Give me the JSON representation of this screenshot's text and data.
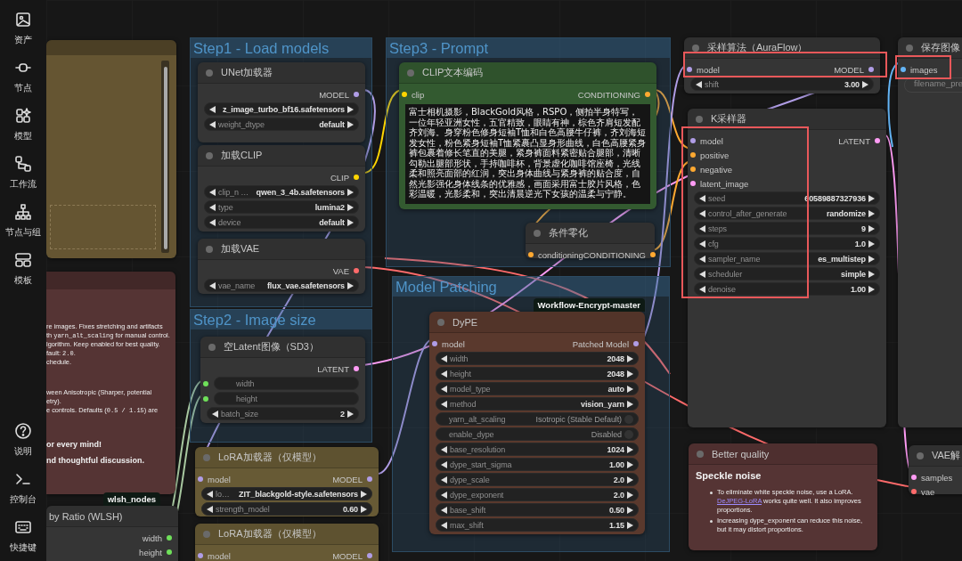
{
  "sidebar": {
    "items": [
      {
        "label": "资产"
      },
      {
        "label": "节点"
      },
      {
        "label": "模型"
      },
      {
        "label": "工作流"
      },
      {
        "label": "节点与组"
      },
      {
        "label": "模板"
      }
    ],
    "bottom_items": [
      {
        "label": "说明"
      },
      {
        "label": "控制台"
      },
      {
        "label": "快捷键"
      }
    ]
  },
  "groups": [
    {
      "title": "Step1 - Load models"
    },
    {
      "title": "Step2 - Image size"
    },
    {
      "title": "Step3 - Prompt"
    },
    {
      "title": "Model Patching"
    }
  ],
  "nodes": [
    {
      "kind": "note",
      "color": "#655532"
    },
    {
      "kind": "markdown",
      "color": "#553434",
      "blocks": [
        [
          [
            {
              "text": "re images. Fixes stretching and artifacts"
            }
          ],
          [
            {
              "text": "th "
            },
            {
              "text": "yarn_alt_scaling",
              "kind": "code"
            },
            {
              "text": " for manual control."
            }
          ],
          [
            {
              "text": "lgorithm. Keep enabled for best quality."
            }
          ],
          [
            {
              "text": "fault: "
            },
            {
              "text": "2.0",
              "kind": "code"
            },
            {
              "text": "."
            }
          ],
          [
            {
              "text": "chedule."
            }
          ]
        ],
        [
          [
            {
              "text": "ween Anisotropic (Sharper, potential"
            }
          ],
          [
            {
              "text": "etry)."
            }
          ],
          [
            {
              "text": "e controls. Defaults ("
            },
            {
              "text": "0.5 / 1.15",
              "kind": "code"
            },
            {
              "text": ") are"
            }
          ]
        ],
        [
          [
            {
              "text": "or every mind!",
              "kind": "bold"
            }
          ],
          [
            {
              "text": "nd thoughtful discussion.",
              "kind": "bold"
            }
          ]
        ]
      ]
    },
    {
      "kind": "node",
      "title": "by Ratio (WLSH)",
      "badge": "wlsh_nodes",
      "outputs": [
        {
          "name": "width",
          "color": "#6fe05a"
        },
        {
          "name": "height",
          "color": "#6fe05a"
        }
      ]
    },
    {
      "kind": "node",
      "title": "UNet加载器",
      "outputs": [
        {
          "name": "MODEL",
          "color": "#b09de6"
        }
      ],
      "widgets": [
        {
          "kind": "value",
          "value": "z_image_turbo_bf16.safetensors"
        },
        {
          "kind": "value",
          "label": "weight_dtype",
          "value": "default"
        }
      ]
    },
    {
      "kind": "node",
      "title": "加载CLIP",
      "outputs": [
        {
          "name": "CLIP",
          "color": "#ffd500"
        }
      ],
      "widgets": [
        {
          "kind": "value",
          "label": "clip_n …",
          "value": "qwen_3_4b.safetensors"
        },
        {
          "kind": "value",
          "label": "type",
          "value": "lumina2"
        },
        {
          "kind": "value",
          "label": "device",
          "value": "default"
        }
      ]
    },
    {
      "kind": "node",
      "title": "加载VAE",
      "outputs": [
        {
          "name": "VAE",
          "color": "#ff6b6b"
        }
      ],
      "widgets": [
        {
          "kind": "value",
          "label": "vae_name",
          "value": "flux_vae.safetensors"
        }
      ]
    },
    {
      "kind": "node",
      "title": "空Latent图像（SD3）",
      "outputs": [
        {
          "name": "LATENT",
          "color": "#ff9cf5"
        }
      ],
      "widgets": [
        {
          "kind": "socket",
          "label": "width",
          "color": "#6fe05a"
        },
        {
          "kind": "socket",
          "label": "height",
          "color": "#6fe05a"
        },
        {
          "kind": "value",
          "label": "batch_size",
          "value": "2"
        }
      ]
    },
    {
      "kind": "node",
      "title": "LoRA加载器（仅模型）",
      "color": "#675a35",
      "inputs": [
        {
          "name": "model",
          "color": "#b09de6"
        }
      ],
      "outputs": [
        {
          "name": "MODEL",
          "color": "#b09de6"
        }
      ],
      "widgets": [
        {
          "kind": "value",
          "label": "lo…",
          "value": "ZIT_blackgold-style.safetensors"
        },
        {
          "kind": "value",
          "label": "strength_model",
          "value": "0.60"
        }
      ]
    },
    {
      "kind": "node",
      "title": "LoRA加载器（仅模型）",
      "color": "#675a35",
      "inputs": [
        {
          "name": "model",
          "color": "#b09de6"
        }
      ],
      "outputs": [
        {
          "name": "MODEL",
          "color": "#b09de6"
        }
      ]
    },
    {
      "kind": "node",
      "title": "CLIP文本编码",
      "color": "#335a30",
      "inputs": [
        {
          "name": "clip",
          "color": "#ffd500"
        }
      ],
      "outputs": [
        {
          "name": "CONDITIONING",
          "color": "#ffa931"
        }
      ],
      "widgets": [
        {
          "kind": "textarea",
          "value": "富士相机摄影，BlackGold风格，RSPO，侧拍半身特写，一位年轻亚洲女性，五官精致，眼睛有神，棕色齐肩短发配齐刘海。身穿粉色修身短袖T恤和白色高腰牛仔裤，齐刘海短发女性，粉色紧身短袖T恤紧裹凸显身形曲线，白色高腰紧身裤包裹着修长笔直的美腿，紧身裤面料紧密贴合腿部，清晰勾勒出腿部形状，手持咖啡杯，背景虚化咖啡馆座椅，光线柔和照亮面部的红润，突出身体曲线与紧身裤的贴合度，自然光影强化身体线条的优雅感，画面采用富士胶片风格，色彩温暖，光影柔和，突出清晨逆光下女孩的温柔与宁静。"
        }
      ]
    },
    {
      "kind": "node",
      "title": "条件零化",
      "inputs": [
        {
          "name": "conditioning",
          "color": "#ffa931"
        }
      ],
      "outputs": [
        {
          "name": "CONDITIONING",
          "color": "#ffa931"
        }
      ]
    },
    {
      "kind": "node",
      "title": "DyPE",
      "color": "#5a392d",
      "badge": "Workflow-Encrypt-master",
      "inputs": [
        {
          "name": "model",
          "color": "#b09de6"
        }
      ],
      "outputs": [
        {
          "name": "Patched Model",
          "color": "#b09de6"
        }
      ],
      "widgets": [
        {
          "kind": "value",
          "label": "width",
          "value": "2048"
        },
        {
          "kind": "value",
          "label": "height",
          "value": "2048"
        },
        {
          "kind": "value",
          "label": "model_type",
          "value": "auto"
        },
        {
          "kind": "value",
          "label": "method",
          "value": "vision_yarn"
        },
        {
          "kind": "toggle",
          "label": "yarn_alt_scaling",
          "value": "Isotropic (Stable Default)",
          "on": false
        },
        {
          "kind": "toggle",
          "label": "enable_dype",
          "value": "Disabled",
          "on": false
        },
        {
          "kind": "value",
          "label": "base_resolution",
          "value": "1024"
        },
        {
          "kind": "value",
          "label": "dype_start_sigma",
          "value": "1.00"
        },
        {
          "kind": "value",
          "label": "dype_scale",
          "value": "2.0"
        },
        {
          "kind": "value",
          "label": "dype_exponent",
          "value": "2.0"
        },
        {
          "kind": "value",
          "label": "base_shift",
          "value": "0.50"
        },
        {
          "kind": "value",
          "label": "max_shift",
          "value": "1.15"
        }
      ]
    },
    {
      "kind": "node",
      "title": "采样算法（AuraFlow）",
      "inputs": [
        {
          "name": "model",
          "color": "#b09de6"
        }
      ],
      "outputs": [
        {
          "name": "MODEL",
          "color": "#b09de6"
        }
      ],
      "widgets": [
        {
          "kind": "value",
          "label": "shift",
          "value": "3.00"
        }
      ]
    },
    {
      "kind": "node",
      "title": "K采样器",
      "inputs": [
        {
          "name": "model",
          "color": "#b09de6"
        },
        {
          "name": "positive",
          "color": "#ffa931"
        },
        {
          "name": "negative",
          "color": "#ffa931"
        },
        {
          "name": "latent_image",
          "color": "#ff9cf5"
        }
      ],
      "outputs": [
        {
          "name": "LATENT",
          "color": "#ff9cf5"
        }
      ],
      "widgets": [
        {
          "kind": "value",
          "label": "seed",
          "value": "60589887327936"
        },
        {
          "kind": "value",
          "label": "control_after_generate",
          "value": "randomize"
        },
        {
          "kind": "value",
          "label": "steps",
          "value": "9"
        },
        {
          "kind": "value",
          "label": "cfg",
          "value": "1.0"
        },
        {
          "kind": "value",
          "label": "sampler_name",
          "value": "es_multistep"
        },
        {
          "kind": "value",
          "label": "scheduler",
          "value": "simple"
        },
        {
          "kind": "value",
          "label": "denoise",
          "value": "1.00"
        }
      ]
    },
    {
      "kind": "node",
      "title": "保存图像",
      "inputs": [
        {
          "name": "images",
          "color": "#64b5f6"
        }
      ],
      "widgets": [
        {
          "kind": "text",
          "label": "filename_pre"
        }
      ]
    },
    {
      "kind": "doc",
      "color": "#553434",
      "title": "Better quality",
      "heading": "Speckle noise",
      "bullets": [
        [
          {
            "text": "To eliminate white speckle noise, use a LoRA. "
          },
          {
            "text": "DeJPEG-LoRA",
            "kind": "link"
          },
          {
            "text": " works quite well. It also improves proportions."
          }
        ],
        [
          {
            "text": "Increasing dype_exponent can reduce this noise, but it may distort proportions."
          }
        ]
      ]
    },
    {
      "kind": "node",
      "title": "VAE解",
      "inputs": [
        {
          "name": "samples",
          "color": "#ff9cf5"
        },
        {
          "name": "vae",
          "color": "#ff6b6b"
        }
      ]
    }
  ],
  "highlights": [
    {
      "kind": "box"
    },
    {
      "kind": "box"
    },
    {
      "kind": "box"
    }
  ]
}
